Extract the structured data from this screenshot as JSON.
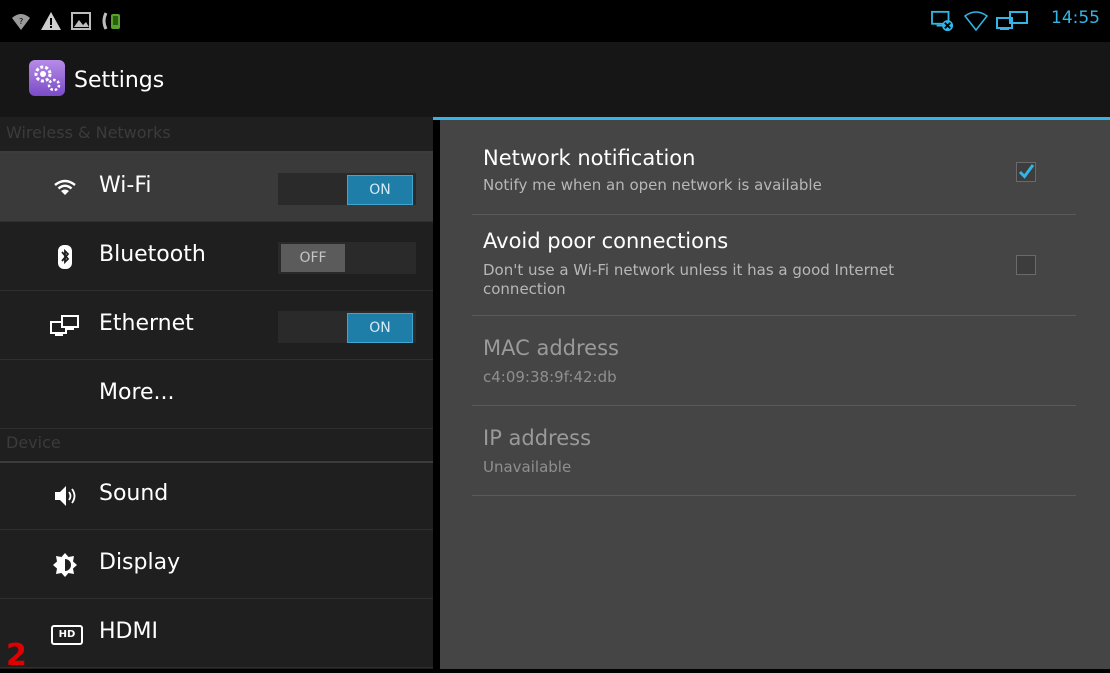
{
  "status_bar": {
    "time": "14:55",
    "icons": [
      "wifi-signal-icon",
      "warning-icon",
      "image-icon",
      "phone-icon",
      "screen-error-icon",
      "wifi-empty-icon",
      "ethernet-connected-icon"
    ]
  },
  "action_bar": {
    "icon": "settings-app-icon",
    "title": "Settings"
  },
  "sections": {
    "wireless": "Wireless & Networks",
    "device": "Device"
  },
  "left_items": [
    {
      "label": "Wi-Fi",
      "icon": "wifi-icon",
      "toggle": "ON"
    },
    {
      "label": "Bluetooth",
      "icon": "bluetooth-icon",
      "toggle": "OFF"
    },
    {
      "label": "Ethernet",
      "icon": "ethernet-icon",
      "toggle": "ON"
    },
    {
      "label": "More..."
    },
    {
      "label": "Sound",
      "icon": "sound-icon"
    },
    {
      "label": "Display",
      "icon": "display-icon"
    },
    {
      "label": "HDMI",
      "icon": "hdmi-icon",
      "badge": "HD"
    }
  ],
  "prefs": [
    {
      "title": "Network notification",
      "summary": "Notify me when an open network is available",
      "checked": true
    },
    {
      "title": "Avoid poor connections",
      "summary": "Don't use a Wi-Fi network unless it has a good Internet connection",
      "checked": false
    },
    {
      "title": "MAC address",
      "summary": "c4:09:38:9f:42:db"
    },
    {
      "title": "IP address",
      "summary": "Unavailable"
    }
  ],
  "corner_mark": "2",
  "colors": {
    "accent": "#33b5e5",
    "background": "#1f1f1f",
    "detail": "#454545"
  }
}
